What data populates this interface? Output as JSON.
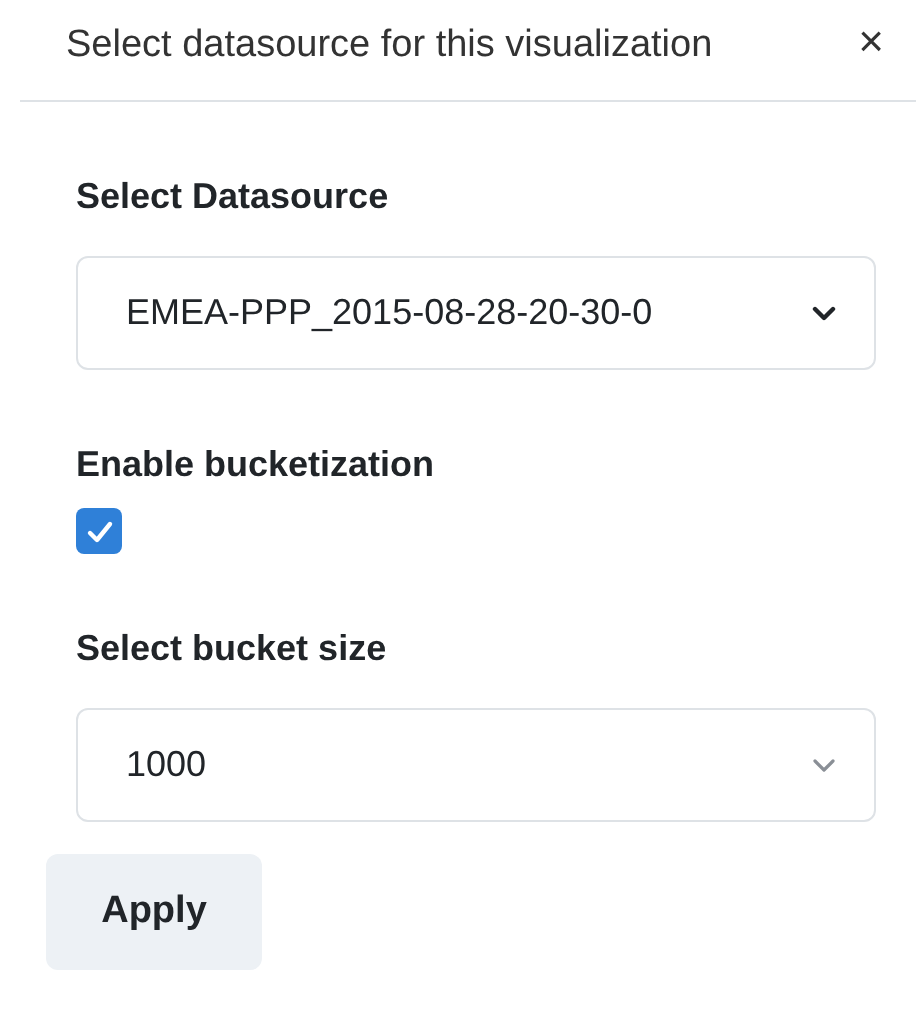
{
  "dialog": {
    "title": "Select datasource for this visualization",
    "close": "×"
  },
  "fields": [
    {
      "kind": "select",
      "label": "Select Datasource",
      "value": "EMEA-PPP_2015-08-28-20-30-0"
    },
    {
      "kind": "checkbox",
      "label": "Enable bucketization",
      "checked": true
    },
    {
      "kind": "select",
      "label": "Select bucket size",
      "value": "1000"
    }
  ],
  "buttons": [
    "Apply"
  ]
}
